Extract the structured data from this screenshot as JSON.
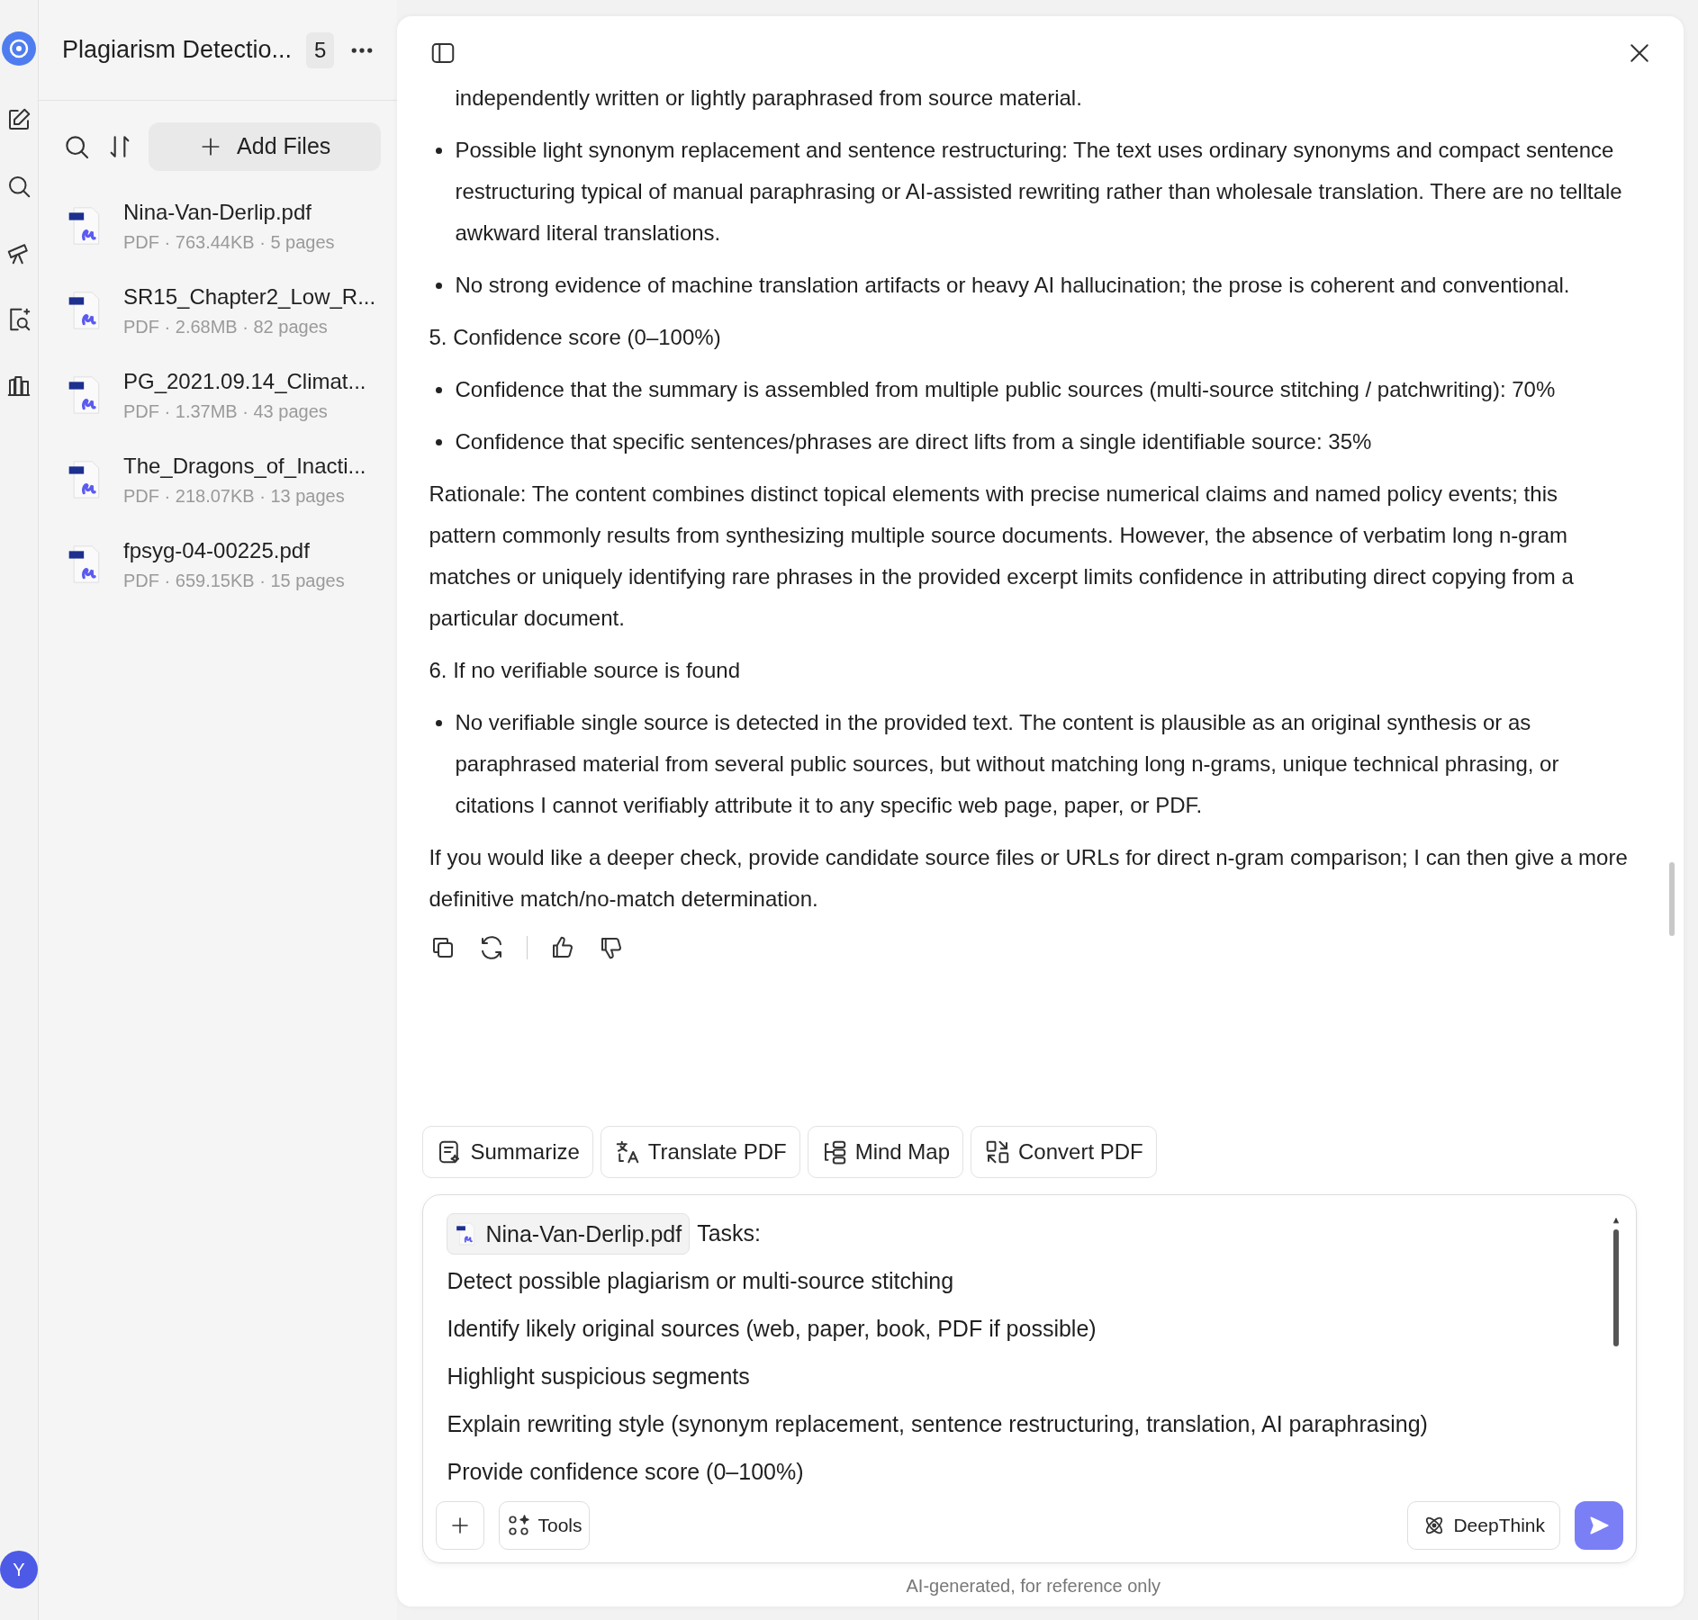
{
  "rail": {
    "avatar": "Y"
  },
  "panel": {
    "title": "Plagiarism Detectio...",
    "count": "5",
    "add_files": "Add Files",
    "files": [
      {
        "name": "Nina-Van-Derlip.pdf",
        "meta": "PDF · 763.44KB · 5 pages"
      },
      {
        "name": "SR15_Chapter2_Low_R...",
        "meta": "PDF · 2.68MB · 82 pages"
      },
      {
        "name": "PG_2021.09.14_Climat...",
        "meta": "PDF · 1.37MB · 43 pages"
      },
      {
        "name": "The_Dragons_of_Inacti...",
        "meta": "PDF · 218.07KB · 13 pages"
      },
      {
        "name": "fpsyg-04-00225.pdf",
        "meta": "PDF · 659.15KB · 15 pages"
      }
    ]
  },
  "message": {
    "blocks": [
      {
        "kind": "continuation",
        "text": "independently written or lightly paraphrased from source material."
      },
      {
        "kind": "bullet",
        "text": "Possible light synonym replacement and sentence restructuring: The text uses ordinary synonyms and compact sentence restructuring typical of manual paraphrasing or AI-assisted rewriting rather than wholesale translation. There are no telltale awkward literal translations."
      },
      {
        "kind": "bullet",
        "text": "No strong evidence of machine translation artifacts or heavy AI hallucination; the prose is coherent and conventional."
      },
      {
        "kind": "heading",
        "text": "5. Confidence score (0–100%)"
      },
      {
        "kind": "bullet",
        "text": "Confidence that the summary is assembled from multiple public sources (multi-source stitching / patchwriting): 70%"
      },
      {
        "kind": "bullet",
        "text": "Confidence that specific sentences/phrases are direct lifts from a single identifiable source: 35%"
      },
      {
        "kind": "paragraph",
        "text": "Rationale: The content combines distinct topical elements with precise numerical claims and named policy events; this pattern commonly results from synthesizing multiple source documents. However, the absence of verbatim long n-gram matches or uniquely identifying rare phrases in the provided excerpt limits confidence in attributing direct copying from a particular document."
      },
      {
        "kind": "heading",
        "text": "6. If no verifiable source is found"
      },
      {
        "kind": "bullet",
        "text": "No verifiable single source is detected in the provided text. The content is plausible as an original synthesis or as paraphrased material from several public sources, but without matching long n-grams, unique technical phrasing, or citations I cannot verifiably attribute it to any specific web page, paper, or PDF."
      },
      {
        "kind": "paragraph",
        "text": "If you would like a deeper check, provide candidate source files or URLs for direct n-gram comparison; I can then give a more definitive match/no-match determination."
      }
    ]
  },
  "quick_actions": [
    {
      "kind": "summarize",
      "label": "Summarize"
    },
    {
      "kind": "translate",
      "label": "Translate PDF"
    },
    {
      "kind": "mindmap",
      "label": "Mind Map"
    },
    {
      "kind": "convert",
      "label": "Convert PDF"
    }
  ],
  "composer": {
    "attachment": "Nina-Van-Derlip.pdf",
    "first_line": "Tasks:",
    "lines": [
      "Detect possible plagiarism or multi-source stitching",
      "Identify likely original sources (web, paper, book, PDF if possible)",
      "Highlight suspicious segments",
      "Explain rewriting style (synonym replacement, sentence restructuring, translation, AI paraphrasing)",
      "Provide confidence score (0–100%)"
    ],
    "tools": "Tools",
    "deepthink": "DeepThink"
  },
  "footer": "AI-generated, for reference only"
}
